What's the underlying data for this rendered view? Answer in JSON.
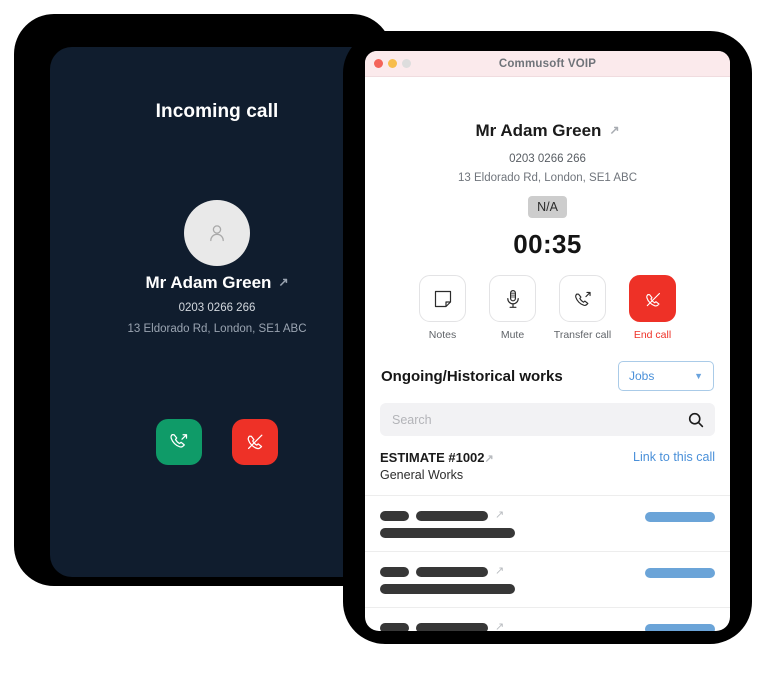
{
  "left_device": {
    "screen_title": "Incoming call",
    "avatar_icon": "person-icon",
    "caller": {
      "name": "Mr Adam Green",
      "external_link_icon": "external-link-arrow-icon",
      "phone": "0203 0266 266",
      "address": "13 Eldorado Rd, London, SE1 ABC"
    },
    "actions": [
      {
        "name": "accept-call",
        "icon": "phone-forward-icon",
        "color": "#0f9b68"
      },
      {
        "name": "decline-call",
        "icon": "phone-hangup-icon",
        "color": "#ee3127"
      }
    ]
  },
  "right_device": {
    "titlebar": {
      "title": "Commusoft VOIP",
      "lights": [
        "close-red",
        "minimize-amber",
        "maximize-grey"
      ]
    },
    "contact": {
      "name": "Mr Adam Green",
      "external_link_icon": "external-link-arrow-icon",
      "phone": "0203 0266 266",
      "address": "13 Eldorado Rd, London, SE1 ABC",
      "status_badge": "N/A"
    },
    "call_timer": "00:35",
    "call_buttons": [
      {
        "label": "Notes",
        "icon": "note-icon",
        "danger": false
      },
      {
        "label": "Mute",
        "icon": "microphone-icon",
        "danger": false
      },
      {
        "label": "Transfer call",
        "icon": "phone-transfer-icon",
        "danger": false
      },
      {
        "label": "End call",
        "icon": "phone-hangup-icon",
        "danger": true
      }
    ],
    "works_section": {
      "title": "Ongoing/Historical works",
      "filter_value": "Jobs",
      "filter_chevron_icon": "chevron-down-icon",
      "search_placeholder": "Search",
      "search_value": "",
      "search_icon": "search-icon"
    },
    "estimate": {
      "title": "ESTIMATE #1002",
      "external_link_icon": "external-link-arrow-icon",
      "subtitle": "General Works",
      "link_label": "Link to this call"
    },
    "redacted_rows": 3
  },
  "colors": {
    "accent_blue": "#4a90d9",
    "danger_red": "#ee3127",
    "accept_green": "#0f9b68",
    "dark_screen": "#101d2e",
    "titlebar_pink": "#fbeaec",
    "redacted_bar": "#373737",
    "redacted_blue_bar": "#6ba4d8"
  }
}
